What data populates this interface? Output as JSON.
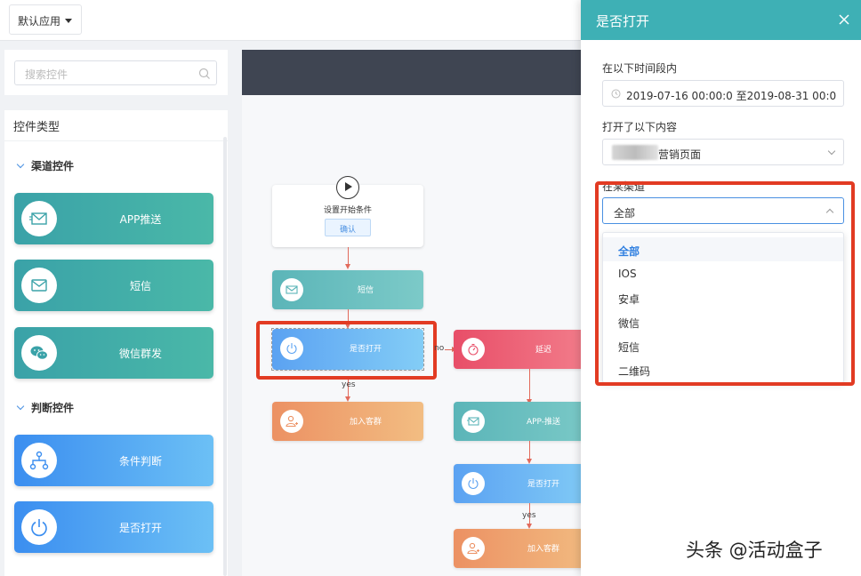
{
  "topbar": {
    "app_select_value": "默认应用"
  },
  "left_panel": {
    "search_placeholder": "搜索控件",
    "title": "控件类型",
    "sections": [
      {
        "label": "渠道控件",
        "items": [
          {
            "label": "APP推送",
            "icon": "app-push-icon"
          },
          {
            "label": "短信",
            "icon": "sms-icon"
          },
          {
            "label": "微信群发",
            "icon": "wechat-icon"
          }
        ]
      },
      {
        "label": "判断控件",
        "items": [
          {
            "label": "条件判断",
            "icon": "branch-icon"
          },
          {
            "label": "是否打开",
            "icon": "power-icon"
          }
        ]
      }
    ]
  },
  "canvas": {
    "start_node": {
      "label": "设置开始条件",
      "confirm": "确认"
    },
    "nodes": {
      "sms": "短信",
      "is_open": "是否打开",
      "add_group": "加入客群",
      "delay": "延迟",
      "app_push": "APP-推送",
      "is_open_2": "是否打开",
      "add_group_2": "加入客群"
    },
    "edges": {
      "yes": "yes",
      "no": "no"
    }
  },
  "drawer": {
    "title": "是否打开",
    "time_label": "在以下时间段内",
    "time_value": "2019-07-16 00:00:0 至2019-08-31 00:00:0",
    "content_label": "打开了以下内容",
    "content_value": "营销页面",
    "channel_label": "在某渠道",
    "channel_value": "全部",
    "options": [
      "全部",
      "IOS",
      "安卓",
      "微信",
      "短信",
      "二维码"
    ]
  },
  "watermark": "头条 @活动盒子",
  "colors": {
    "accent": "#3eb0b5",
    "highlight": "#e23b23",
    "link": "#2f7fe0"
  }
}
